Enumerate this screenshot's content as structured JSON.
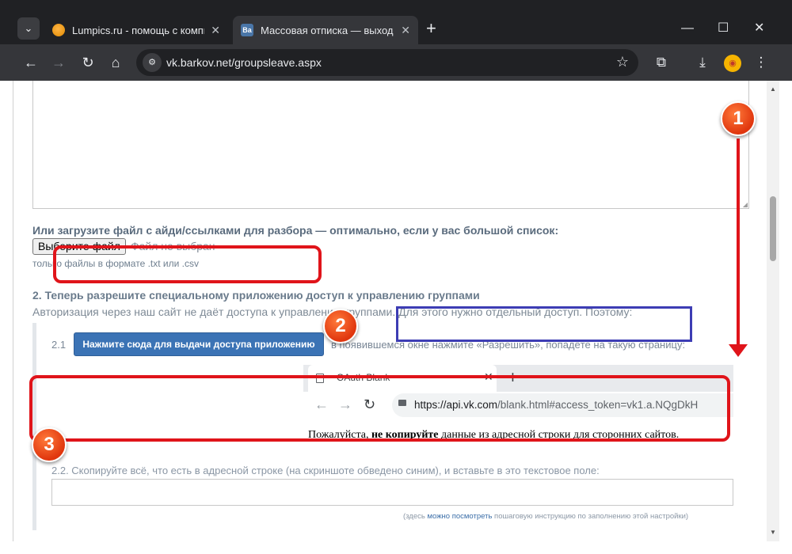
{
  "browser": {
    "tabs": [
      {
        "title": "Lumpics.ru - помощь с компьютером",
        "close": "✕"
      },
      {
        "title": "Массовая отписка — выход из групп",
        "favicon_text": "Ва",
        "close": "✕"
      }
    ],
    "new_tab": "+",
    "window_controls": {
      "minimize": "—",
      "maximize": "☐",
      "close": "✕"
    },
    "address_bar": {
      "url": "vk.barkov.net/groupsleave.aspx"
    }
  },
  "page": {
    "upload_heading": "Или загрузите файл с айди/ссылками для разбора — оптимально, если у вас большой список:",
    "file_button": "Выберите файл",
    "file_status": "Файл не выбран",
    "file_hint": "только файлы в формате .txt или .csv",
    "step2_heading": "2. Теперь разрешите специальному приложению доступ к управлению группами",
    "step2_desc": "Авторизация через наш сайт не даёт доступа к управлению группами. Для этого нужно отдельный доступ. Поэтому:",
    "step21_label": "2.1",
    "auth_button": "Нажмите сюда для выдачи доступа приложению",
    "step21_after": "в появившемся окне нажмите «Разрешить», попадёте на такую страницу:",
    "screenshot": {
      "tab_title": "OAuth Blank",
      "url_host": "https://api.vk.com",
      "url_path": "/blank.html#access_token=vk1.a.NQgDkH"
    },
    "warning_prefix": "Пожалуйста, ",
    "warning_bold": "не копируйте",
    "warning_suffix": " данные из адресной строки для сторонних сайтов.",
    "step22_label": "2.2. Скопируйте всё, что есть в адресной строке (на скриншоте обведено синим), и вставьте в это текстовое поле:",
    "footnote_prefix": "(здесь ",
    "footnote_link": "можно посмотреть",
    "footnote_suffix": " пошаговую инструкцию по заполнению этой настройки)"
  },
  "annotations": {
    "markers": [
      "1",
      "2",
      "3"
    ],
    "highlight_color": "#e0141a",
    "url_highlight_color": "#3d3db4"
  },
  "colors": {
    "accent_button": "#3b73b5",
    "chrome_dark": "#202124"
  }
}
